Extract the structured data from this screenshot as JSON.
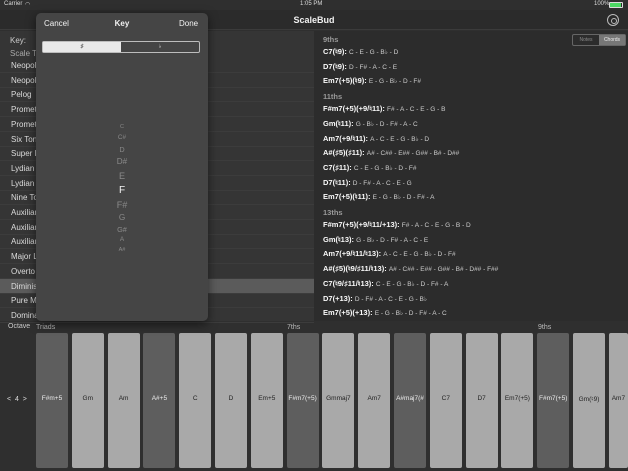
{
  "status": {
    "carrier": "Carrier",
    "wifi": "wifi-icon",
    "time": "1:05 PM",
    "battery": "100%"
  },
  "nav": {
    "title": "ScaleBud"
  },
  "left": {
    "key_label": "Key:",
    "list_head": "Scale T",
    "scales": [
      "Neopol",
      "Neopol",
      "Pelog",
      "Promet",
      "Promet",
      "Six Ton",
      "Super L",
      "Lydian",
      "Lydian",
      "Nine To",
      "Auxiliar",
      "Auxiliar",
      "Auxiliar",
      "Major L",
      "Overto",
      "Diminis",
      "Pure M",
      "Domina"
    ],
    "selected_index": 15
  },
  "right": {
    "segment": {
      "notes": "Notes",
      "chords": "Chords"
    },
    "sections": [
      {
        "title": "9ths",
        "chords": [
          {
            "name": "C7(♮9):",
            "notes": "C - E - G - B♭ - D"
          },
          {
            "name": "D7(♮9):",
            "notes": "D - F# - A - C - E"
          },
          {
            "name": "Em7(+5)(♮9):",
            "notes": "E - G - B♭ - D - F#"
          }
        ]
      },
      {
        "title": "11ths",
        "chords": [
          {
            "name": "F#m7(+5)(+9/♮11):",
            "notes": "F# - A - C - E - G - B"
          },
          {
            "name": "Gm(♮11):",
            "notes": "G - B♭ - D - F# - A - C"
          },
          {
            "name": "Am7(+9/♮11):",
            "notes": "A - C - E - G - B♭ - D"
          },
          {
            "name": "A#(♯5)(♯11):",
            "notes": "A# - C## - E## - G## - B# - D##"
          },
          {
            "name": "C7(♯11):",
            "notes": "C - E - G - B♭ - D - F#"
          },
          {
            "name": "D7(♮11):",
            "notes": "D - F# - A - C - E - G"
          },
          {
            "name": "Em7(+5)(♮11):",
            "notes": "E - G - B♭ - D - F# - A"
          }
        ]
      },
      {
        "title": "13ths",
        "chords": [
          {
            "name": "F#m7(+5)(+9/♮11/+13):",
            "notes": "F# - A - C - E - G - B - D"
          },
          {
            "name": "Gm(♮13):",
            "notes": "G - B♭ - D - F# - A - C - E"
          },
          {
            "name": "Am7(+9/♮11/♮13):",
            "notes": "A - C - E - G - B♭ - D - F#"
          },
          {
            "name": "A#(♯5)(♮9/♯11/♮13):",
            "notes": "A# - C## - E## - G## - B# - D## - F##"
          },
          {
            "name": "C7(♮9/♯11/♮13):",
            "notes": "C - E - G - B♭ - D - F# - A"
          },
          {
            "name": "D7(+13):",
            "notes": "D - F# - A - C - E - G - B♭"
          },
          {
            "name": "Em7(+5)(+13):",
            "notes": "E - G - B♭ - D - F# - A - C"
          }
        ]
      }
    ]
  },
  "keyboard": {
    "octave_label": "Octave",
    "octave_value": "4",
    "octave_prev": "<",
    "octave_next": ">",
    "groups": [
      "Triads",
      "7ths",
      "9ths"
    ],
    "keys": [
      {
        "label": "F#m+5",
        "shade": "dark"
      },
      {
        "label": "Gm",
        "shade": "light"
      },
      {
        "label": "Am",
        "shade": "light"
      },
      {
        "label": "A#+5",
        "shade": "dark"
      },
      {
        "label": "C",
        "shade": "light"
      },
      {
        "label": "D",
        "shade": "light"
      },
      {
        "label": "Em+5",
        "shade": "light"
      },
      {
        "label": "F#m7(+5)",
        "shade": "dark"
      },
      {
        "label": "Gmmaj7",
        "shade": "light"
      },
      {
        "label": "Am7",
        "shade": "light"
      },
      {
        "label": "A#maj7(#",
        "shade": "dark"
      },
      {
        "label": "C7",
        "shade": "light"
      },
      {
        "label": "D7",
        "shade": "light"
      },
      {
        "label": "Em7(+5)",
        "shade": "light"
      },
      {
        "label": "F#m7(+5)",
        "shade": "dark"
      },
      {
        "label": "Gm(♮9)",
        "shade": "light"
      },
      {
        "label": "Am7",
        "shade": "light"
      }
    ]
  },
  "popover": {
    "cancel": "Cancel",
    "title": "Key",
    "done": "Done",
    "segment": {
      "sharp": "♯",
      "flat": "♭"
    },
    "wheel": [
      "C",
      "C#",
      "D",
      "D#",
      "E",
      "F",
      "F#",
      "G",
      "G#",
      "A",
      "A#"
    ],
    "selected": "F"
  }
}
